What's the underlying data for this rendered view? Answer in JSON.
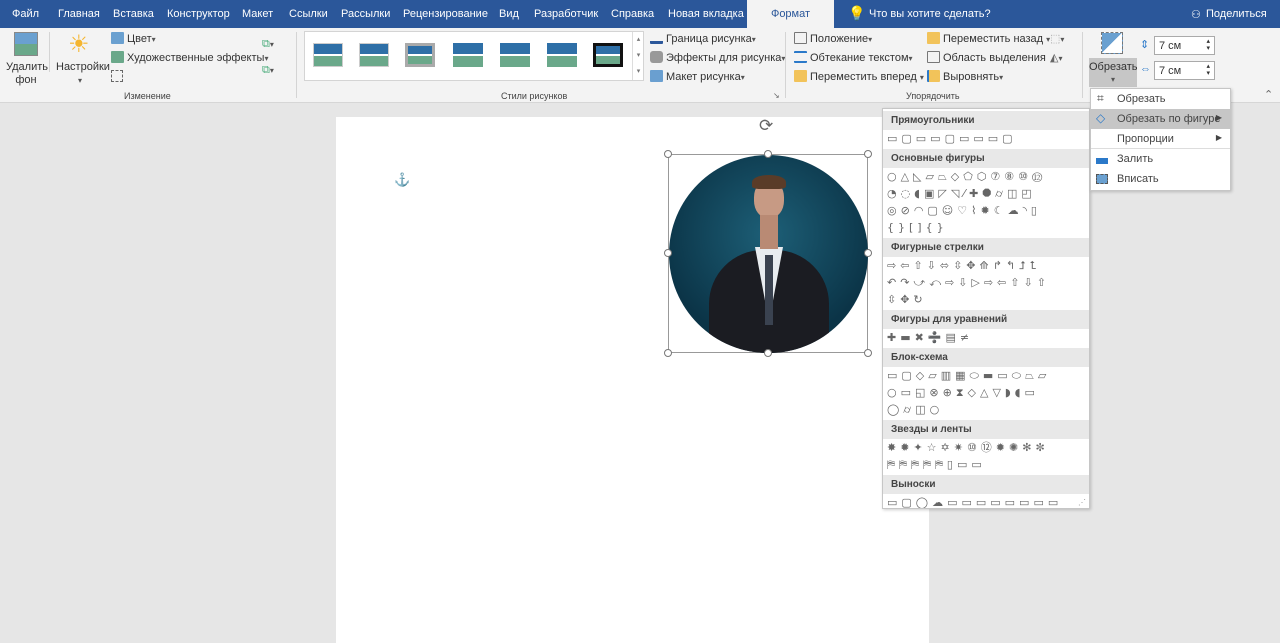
{
  "tabs": [
    "Файл",
    "Главная",
    "Вставка",
    "Конструктор",
    "Макет",
    "Ссылки",
    "Рассылки",
    "Рецензирование",
    "Вид",
    "Разработчик",
    "Справка",
    "Новая вкладка"
  ],
  "active_tab": "Формат",
  "tell_me": "Что вы хотите сделать?",
  "share": "Поделиться",
  "ribbon": {
    "remove_bg": [
      "Удалить",
      "фон"
    ],
    "corrections": "Настройки",
    "color": "Цвет",
    "artistic": "Художественные эффекты",
    "group_adjust": "Изменение",
    "group_styles": "Стили рисунков",
    "border": "Граница рисунка",
    "effects": "Эффекты для рисунка",
    "layout": "Макет рисунка",
    "position": "Положение",
    "wrap": "Обтекание текстом",
    "forward": "Переместить вперед",
    "backward": "Переместить назад",
    "selection_pane": "Область выделения",
    "align": "Выровнять",
    "group_arrange": "Упорядочить",
    "crop": "Обрезать",
    "height": "7 см",
    "width": "7 см"
  },
  "crop_menu": [
    "Обрезать",
    "Обрезать по фигуре",
    "Пропорции",
    "Залить",
    "Вписать"
  ],
  "shape_sections": [
    {
      "title": "Прямоугольники",
      "rows": [
        "▭▢▭▭▢▭▭▭▢"
      ]
    },
    {
      "title": "Основные фигуры",
      "rows": [
        "○△◺▱⏢◇⬠⬡⑦⑧⑩⑫",
        "◔◌◖▣◸◹⁄✚⯃⌭◫◰",
        "◎⊘◠▢☺♡⌇✹☾☁◝▯",
        "{}[]{}"
      ]
    },
    {
      "title": "Фигурные стрелки",
      "rows": [
        "⇨⇦⇧⇩⬄⇳✥⟰↱↰⮥⮤",
        "↶↷⤻⤺⇨⇩▷⇨⇦⇧⇩⇧",
        "⇳✥↻"
      ]
    },
    {
      "title": "Фигуры для уравнений",
      "rows": [
        "✚▬✖➗▤≠"
      ]
    },
    {
      "title": "Блок-схема",
      "rows": [
        "▭▢◇▱▥▦⬭▬▭⬭⏢⏥",
        "○▭◱⊗⊕⧗◇△▽◗◖▭",
        "◯⌭◫○"
      ]
    },
    {
      "title": "Звезды и ленты",
      "rows": [
        "✸✹✦☆✡✷⑩⑫✹✺✻✼",
        "⛿⛿⛿⛿⛿▯▭▭"
      ]
    },
    {
      "title": "Выноски",
      "rows": [
        "▭▢◯☁▭▭▭▭▭▭▭▭",
        "▭▭▭▭"
      ]
    }
  ],
  "colors": {
    "accent": "#2b579a"
  }
}
